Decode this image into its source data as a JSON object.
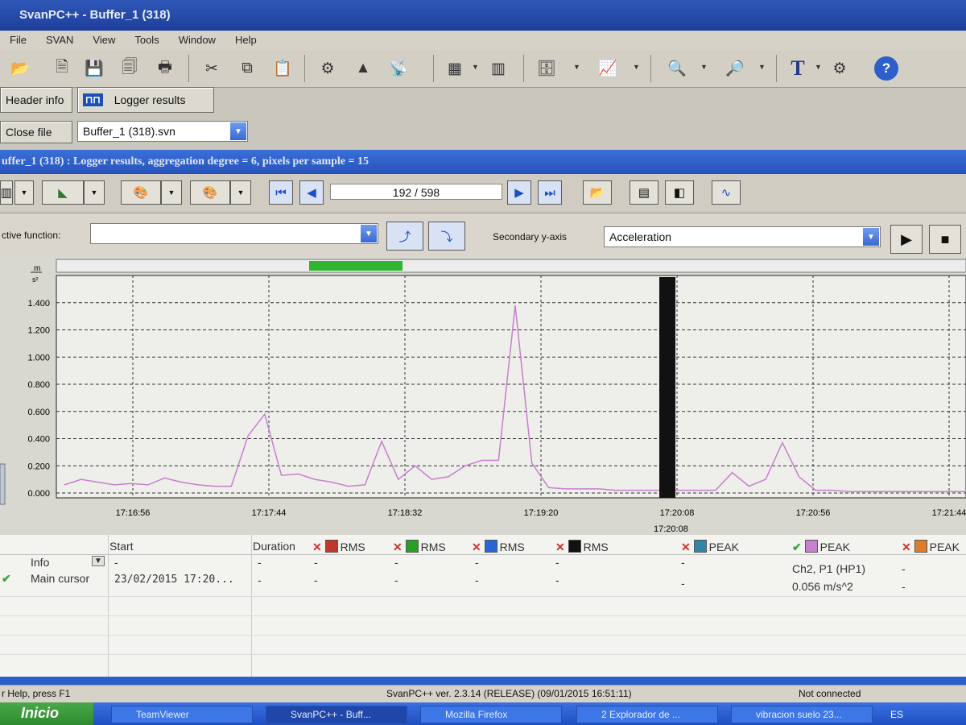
{
  "window": {
    "title": "SvanPC++ - Buffer_1 (318)"
  },
  "menu": [
    "File",
    "SVAN",
    "View",
    "Tools",
    "Window",
    "Help"
  ],
  "toolbar": {
    "icons": [
      "open-folder-icon",
      "save-as-icon",
      "save-icon",
      "export-icon",
      "print-icon",
      "cut-icon",
      "copy-icon",
      "paste-icon",
      "gear-icon",
      "probe-icon",
      "satellite-icon",
      "calculator-icon",
      "bar-chart-icon",
      "db-icon",
      "lin-icon",
      "zoom-in-icon",
      "zoom-out-icon",
      "text-icon",
      "settings-icon",
      "help-icon"
    ],
    "text_tool": "T",
    "help": "?"
  },
  "modes": {
    "header_info": "Header info",
    "logger_results": "Logger results"
  },
  "file": {
    "close_label": "Close file",
    "selected": "Buffer_1 (318).svn"
  },
  "inner": {
    "caption": "uffer_1 (318) : Logger results, aggregation degree = 6, pixels per sample = 15",
    "counter": "192 / 598"
  },
  "functions": {
    "active_label": "ctive function:",
    "active_value": "",
    "secondary_label": "Secondary y-axis",
    "secondary_value": "Acceleration"
  },
  "chart_data": {
    "type": "line",
    "ylabel_num": "m",
    "ylabel_den": "s²",
    "y_ticks": [
      "0.000",
      "0.200",
      "0.400",
      "0.600",
      "0.800",
      "1.000",
      "1.200",
      "1.400"
    ],
    "ylim": [
      0,
      1.6
    ],
    "x_ticks": [
      "17:16:56",
      "17:17:44",
      "17:18:32",
      "17:19:20",
      "17:20:08",
      "17:20:56",
      "17:21:44"
    ],
    "cursor_label": "17:20:08",
    "grid": true,
    "series": [
      {
        "color": "#c77fcf",
        "values": [
          0.06,
          0.1,
          0.08,
          0.06,
          0.07,
          0.06,
          0.11,
          0.08,
          0.06,
          0.05,
          0.05,
          0.42,
          0.58,
          0.13,
          0.14,
          0.1,
          0.08,
          0.05,
          0.06,
          0.38,
          0.1,
          0.2,
          0.1,
          0.12,
          0.2,
          0.24,
          0.24,
          1.38,
          0.22,
          0.04,
          0.03,
          0.03,
          0.03,
          0.02,
          0.02,
          0.02,
          0.02,
          0.02,
          0.02,
          0.02,
          0.15,
          0.05,
          0.1,
          0.37,
          0.12,
          0.02,
          0.02,
          0.01,
          0.01,
          0.01,
          0.01,
          0.01,
          0.01,
          0.01,
          0.01
        ]
      }
    ]
  },
  "table": {
    "headers": {
      "start": "Start",
      "duration": "Duration"
    },
    "columns": [
      {
        "mark": "✕",
        "color": "#c0392b",
        "label": "RMS",
        "enabled": false
      },
      {
        "mark": "✕",
        "color": "#28a028",
        "label": "RMS",
        "enabled": false
      },
      {
        "mark": "✕",
        "color": "#2766d8",
        "label": "RMS",
        "enabled": false
      },
      {
        "mark": "✕",
        "color": "#111111",
        "label": "RMS",
        "enabled": false
      },
      {
        "mark": "✕",
        "color": "#2f86a8",
        "label": "PEAK",
        "enabled": false
      },
      {
        "mark": "✔",
        "color": "#c77fcf",
        "label": "PEAK",
        "enabled": true
      },
      {
        "mark": "✕",
        "color": "#e07b2a",
        "label": "PEAK",
        "enabled": false
      }
    ],
    "rows": [
      {
        "label": "Info",
        "start": "-",
        "duration": "-",
        "c1": "-",
        "c2": "-",
        "c3": "-",
        "c4": "-",
        "c5": "-",
        "c6": "Ch2, P1 (HP1)",
        "c7": "-"
      },
      {
        "label": "Main cursor",
        "start": "23/02/2015 17:20...",
        "duration": "-",
        "c1": "-",
        "c2": "-",
        "c3": "-",
        "c4": "-",
        "c5": "-",
        "c6": "0.056 m/s^2",
        "c7": "-"
      }
    ]
  },
  "status": {
    "help": "r Help, press F1",
    "version": "SvanPC++ ver. 2.3.14 (RELEASE) (09/01/2015 16:51:11)",
    "connection": "Not connected"
  },
  "taskbar": {
    "start": "Inicio",
    "items": [
      "TeamViewer",
      "SvanPC++ - Buff...",
      "Mozilla Firefox",
      "2 Explorador de ...",
      "vibracion suelo 23..."
    ],
    "lang": "ES"
  }
}
